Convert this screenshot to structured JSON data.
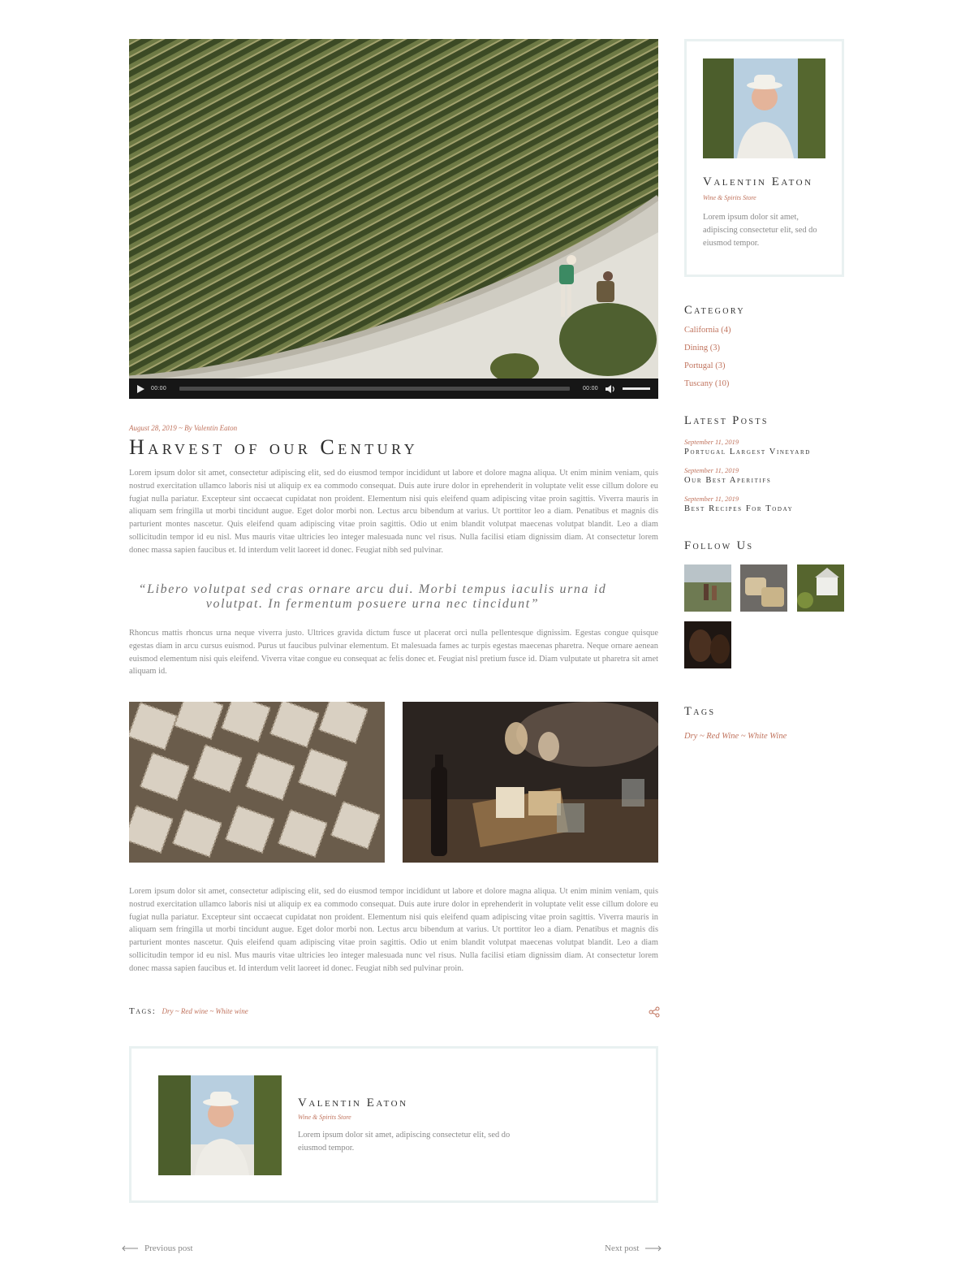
{
  "video": {
    "current_time": "00:00",
    "duration": "00:00",
    "progress": 0,
    "volume": 1
  },
  "post": {
    "date": "August 28, 2019",
    "separator": "~",
    "byline": "By Valentin Eaton",
    "title": "Harvest of our Century",
    "paragraph_1": "Lorem ipsum dolor sit amet, consectetur adipiscing elit, sed do eiusmod tempor incididunt ut labore et dolore magna aliqua. Ut enim minim veniam, quis nostrud exercitation ullamco laboris nisi ut aliquip ex ea commodo consequat. Duis aute irure dolor in eprehenderit in voluptate velit esse cillum dolore eu fugiat nulla pariatur. Excepteur sint occaecat cupidatat non proident. Elementum nisi quis eleifend quam adipiscing vitae proin sagittis. Viverra mauris in aliquam sem fringilla ut morbi tincidunt augue. Eget dolor morbi non. Lectus arcu bibendum at varius. Ut porttitor leo a diam. Penatibus et magnis dis parturient montes nascetur. Quis eleifend quam adipiscing vitae proin sagittis. Odio ut enim blandit volutpat maecenas volutpat blandit. Leo a diam sollicitudin tempor id eu nisl. Mus mauris vitae ultricies leo integer malesuada nunc vel risus. Nulla facilisi etiam dignissim diam. At consectetur lorem donec massa sapien faucibus et. Id interdum velit laoreet id donec. Feugiat nibh sed pulvinar.",
    "quote": "“Libero volutpat sed cras ornare arcu dui. Morbi tempus iaculis urna id volutpat. In fermentum posuere urna nec tincidunt”",
    "paragraph_2": "Rhoncus mattis rhoncus urna neque viverra justo. Ultrices gravida dictum fusce ut placerat orci nulla pellentesque dignissim. Egestas congue quisque egestas diam in arcu cursus euismod. Purus ut faucibus pulvinar elementum. Et malesuada fames ac turpis egestas maecenas pharetra. Neque ornare aenean euismod elementum nisi quis eleifend. Viverra vitae congue eu consequat ac felis donec et. Feugiat nisl pretium fusce id. Diam vulputate ut pharetra sit amet aliquam id.",
    "paragraph_3": "Lorem ipsum dolor sit amet, consectetur adipiscing elit, sed do eiusmod tempor incididunt ut labore et dolore magna aliqua. Ut enim minim veniam, quis nostrud exercitation ullamco laboris nisi ut aliquip ex ea commodo consequat. Duis aute irure dolor in eprehenderit in voluptate velit esse cillum dolore eu fugiat nulla pariatur. Excepteur sint occaecat cupidatat non proident. Elementum nisi quis eleifend quam adipiscing vitae proin sagittis. Viverra mauris in aliquam sem fringilla ut morbi tincidunt augue. Eget dolor morbi non. Lectus arcu bibendum at varius. Ut porttitor leo a diam. Penatibus et magnis dis parturient montes nascetur. Quis eleifend quam adipiscing vitae proin sagittis. Odio ut enim blandit volutpat maecenas volutpat blandit. Leo a diam sollicitudin tempor id eu nisl. Mus mauris vitae ultricies leo integer malesuada nunc vel risus. Nulla facilisi etiam dignissim diam. At consectetur lorem donec massa sapien faucibus et. Id interdum velit laoreet id donec. Feugiat nibh sed pulvinar proin.",
    "tags_label": "Tags:",
    "tags": "Dry ~ Red wine ~ White wine"
  },
  "author_box": {
    "name": "Valentin Eaton",
    "subtitle": "Wine & Spirits Store",
    "description": "Lorem ipsum dolor sit amet, adipiscing consectetur elit, sed do eiusmod tempor."
  },
  "post_nav": {
    "previous": "Previous post",
    "next": "Next post"
  },
  "sidebar": {
    "author": {
      "name": "Valentin Eaton",
      "subtitle": "Wine & Spirits Store",
      "description": "Lorem ipsum dolor sit amet, adipiscing consectetur elit, sed do eiusmod tempor."
    },
    "category_title": "Category",
    "categories": [
      {
        "label": "California (4)"
      },
      {
        "label": "Dining (3)"
      },
      {
        "label": "Portugal (3)"
      },
      {
        "label": "Tuscany (10)"
      }
    ],
    "latest_title": "Latest Posts",
    "latest_posts": [
      {
        "date": "September 11, 2019",
        "title": "Portugal Largest Vineyard"
      },
      {
        "date": "September 11, 2019",
        "title": "Our Best Aperitifs"
      },
      {
        "date": "September 11, 2019",
        "title": "Best Recipes For Today"
      }
    ],
    "follow_title": "Follow Us",
    "tags_title": "Tags",
    "tags": "Dry ~ Red Wine ~ White Wine"
  },
  "colors": {
    "accent": "#c0735d",
    "border": "#e9f1f1",
    "heading": "#2d2d2d",
    "body_text": "#8a8a8a"
  }
}
